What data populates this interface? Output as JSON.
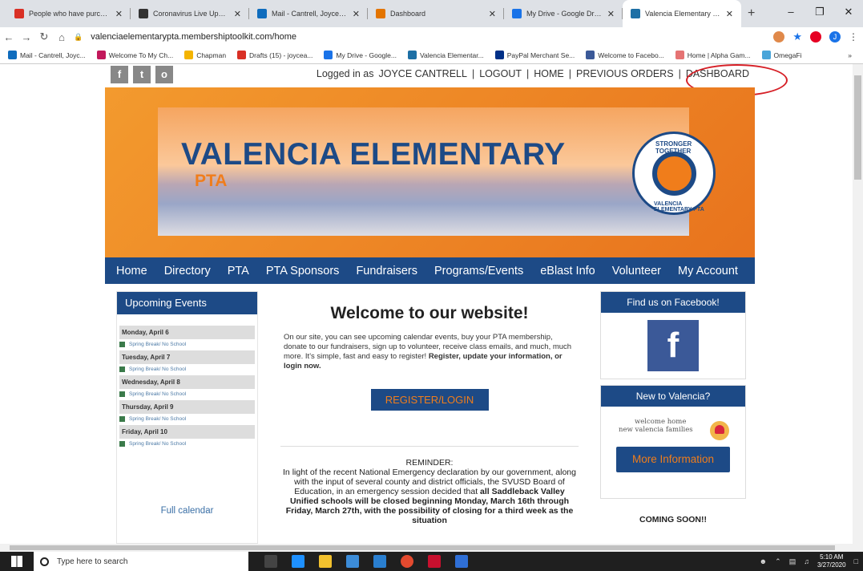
{
  "browser": {
    "tabs": [
      {
        "title": "People who have purchasec",
        "color": "#d93025"
      },
      {
        "title": "Coronavirus Live Updates: U",
        "color": "#333333"
      },
      {
        "title": "Mail - Cantrell, Joyce - Outl",
        "color": "#0f6cbd"
      },
      {
        "title": "Dashboard",
        "color": "#e37400"
      },
      {
        "title": "My Drive - Google Drive",
        "color": "#1a73e8"
      },
      {
        "title": "Valencia Elementary PTA - S",
        "color": "#1d6fa5"
      }
    ],
    "new_tab": "+",
    "url": "valenciaelementarypta.membershiptoolkit.com/home",
    "bookmarks": [
      "Mail - Cantrell, Joyc...",
      "Welcome To My Ch...",
      "Chapman",
      "Drafts (15) - joycea...",
      "My Drive - Google...",
      "Valencia Elementar...",
      "PayPal Merchant Se...",
      "Welcome to Facebo...",
      "Home | Alpha Gam...",
      "OmegaFi"
    ],
    "bookmark_overflow": "»",
    "profile_initial": "J"
  },
  "site": {
    "social": [
      "f",
      "t",
      "o"
    ],
    "login": {
      "prefix": "Logged in as",
      "user": "JOYCE CANTRELL",
      "logout": "LOGOUT",
      "home": "HOME",
      "previous_orders": "PREVIOUS ORDERS",
      "dashboard": "DASHBOARD",
      "sep": "|"
    },
    "banner": {
      "title": "VALENCIA ELEMENTARY",
      "subtitle": "PTA",
      "seal_top": "STRONGER TOGETHER",
      "seal_bottom": "VALENCIA ELEMENTARY PTA"
    },
    "menu": [
      "Home",
      "Directory",
      "PTA",
      "PTA Sponsors",
      "Fundraisers",
      "Programs/Events",
      "eBlast Info",
      "Volunteer",
      "My Account"
    ],
    "events": {
      "header": "Upcoming Events",
      "days": [
        {
          "day": "Monday, April 6",
          "item": "Spring Break/ No School"
        },
        {
          "day": "Tuesday, April 7",
          "item": "Spring Break/ No School"
        },
        {
          "day": "Wednesday, April 8",
          "item": "Spring Break/ No School"
        },
        {
          "day": "Thursday, April 9",
          "item": "Spring Break/ No School"
        },
        {
          "day": "Friday, April 10",
          "item": "Spring Break/ No School"
        }
      ],
      "full_calendar": "Full calendar"
    },
    "main": {
      "heading": "Welcome to our website!",
      "intro": "On our site, you can see upcoming calendar events, buy your PTA membership, donate to our fundraisers, sign up to volunteer, receive class emails, and much, much more. It's simple, fast and easy to register!",
      "intro_bold": "Register, update your information, or login now.",
      "register_button": "REGISTER/LOGIN",
      "reminder_title": "REMINDER:",
      "reminder_text": "In light of the recent National Emergency declaration by our government, along with the input of several county and district officials, the SVUSD Board of Education, in an emergency session decided that",
      "reminder_bold": "all Saddleback Valley Unified schools will be closed beginning Monday, March 16th through Friday, March 27th, with the possibility of closing for a third week as the situation"
    },
    "sidebar": {
      "facebook_header": "Find us on Facebook!",
      "facebook_logo": "f",
      "new_header": "New to Valencia?",
      "welcome_line1": "welcome home",
      "welcome_line2": "new valencia families",
      "more_button": "More Information",
      "coming_soon": "COMING SOON!!"
    }
  },
  "taskbar": {
    "search_placeholder": "Type here to search",
    "time": "5:10 AM",
    "date": "3/27/2020"
  }
}
